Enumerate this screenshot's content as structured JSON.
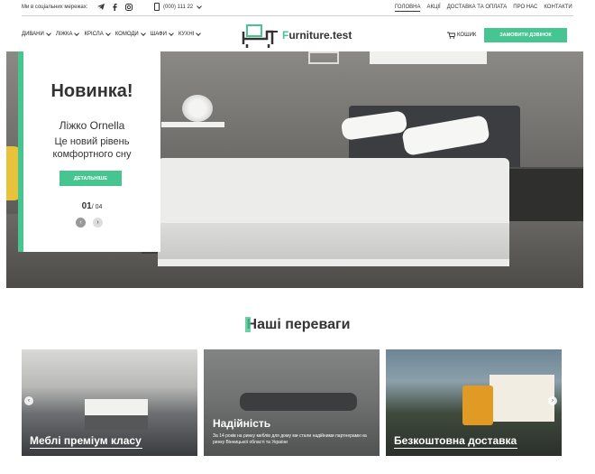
{
  "topbar": {
    "social_label": "Ми в соціальних мережах:",
    "social_icons": [
      "telegram-icon",
      "facebook-icon",
      "instagram-icon"
    ],
    "phone": "(000) 111 22",
    "nav": [
      {
        "label": "ГОЛОВНА",
        "active": true
      },
      {
        "label": "АКЦІЇ",
        "active": false
      },
      {
        "label": "ДОСТАВКА ТА ОПЛАТА",
        "active": false
      },
      {
        "label": "ПРО НАС",
        "active": false
      },
      {
        "label": "КОНТАКТИ",
        "active": false
      }
    ]
  },
  "header": {
    "categories": [
      "ДИВАНИ",
      "ЛІЖКА",
      "КРІСЛА",
      "КОМОДИ",
      "ШАФИ",
      "КУХНІ"
    ],
    "logo_first_letter": "F",
    "logo_rest": "urniture.test",
    "cart_label": "КОШИК",
    "callback_label": "ЗАМОВИТИ ДЗВІНОК"
  },
  "hero": {
    "title": "Новинка!",
    "product": "Ліжко Ornella",
    "description": "Це новий рівень комфортного сну",
    "button": "ДЕТАЛЬНІШЕ",
    "current": "01",
    "total": "/ 04"
  },
  "advantages": {
    "title": "Наші переваги",
    "cards": [
      {
        "title": "Меблі преміум класу"
      },
      {
        "title": "Надійність",
        "text": "За 14 років на ринку меблів для дому ми стали надійними партнерами на ринку Вінницької області та України"
      },
      {
        "title": "Безкоштовна доставка"
      }
    ]
  },
  "colors": {
    "accent": "#47c590",
    "text": "#333333"
  }
}
